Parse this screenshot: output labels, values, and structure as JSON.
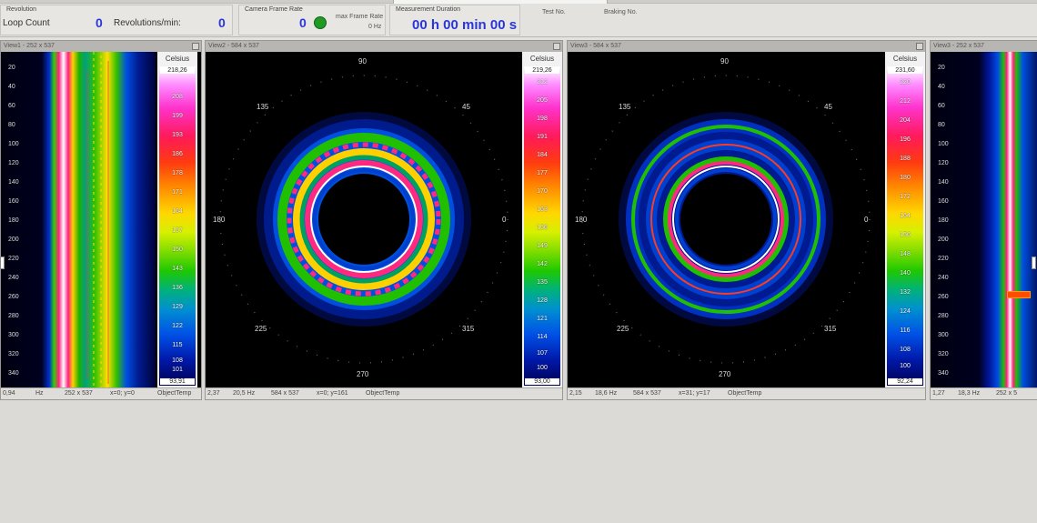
{
  "topbar": {
    "revolution_title": "Revolution",
    "loop_count_label": "Loop Count",
    "loop_count_value": "0",
    "revs_label": "Revolutions/min:",
    "revs_value": "0",
    "frame_rate_title": "Camera Frame Rate",
    "frame_rate_value": "0",
    "max_frame_rate_label": "max Frame Rate",
    "max_frame_rate_unit": "0 Hz",
    "duration_title": "Measurement Duration",
    "duration_value": "00 h 00 min 00 s",
    "test_no_label": "Test No.",
    "braking_no_label": "Braking No."
  },
  "views": {
    "view1": {
      "title": "View1 - 252 x 537",
      "scale_unit": "Celsius",
      "scale_max": "218,26",
      "scale_min": "93,91",
      "scale_ticks": [
        "208",
        "199",
        "193",
        "186",
        "178",
        "171",
        "164",
        "157",
        "150",
        "143",
        "136",
        "129",
        "122",
        "115",
        "108",
        "101"
      ],
      "y_ticks": [
        "20",
        "40",
        "60",
        "80",
        "100",
        "120",
        "140",
        "160",
        "180",
        "200",
        "220",
        "240",
        "260",
        "280",
        "300",
        "320",
        "340"
      ],
      "status": [
        "0,94",
        "Hz",
        "252 x 537",
        "x=0; y=0",
        "ObjectTemp"
      ]
    },
    "view2": {
      "title": "View2 - 584 x 537",
      "scale_unit": "Celsius",
      "scale_max": "219,26",
      "scale_min": "93,00",
      "scale_ticks": [
        "212",
        "205",
        "198",
        "191",
        "184",
        "177",
        "170",
        "163",
        "156",
        "149",
        "142",
        "135",
        "128",
        "121",
        "114",
        "107",
        "100"
      ],
      "angles": {
        "a90": "90",
        "a45": "45",
        "a135": "135",
        "a180": "180",
        "a0": "0",
        "a225": "225",
        "a315": "315",
        "a270": "270"
      },
      "status": [
        "2,37",
        "20,5 Hz",
        "584 x 537",
        "x=0; y=161",
        "ObjectTemp"
      ]
    },
    "view3": {
      "title": "View3 - 584 x 537",
      "scale_unit": "Celsius",
      "scale_max": "231,60",
      "scale_min": "92,24",
      "scale_ticks": [
        "220",
        "212",
        "204",
        "196",
        "188",
        "180",
        "172",
        "164",
        "156",
        "148",
        "140",
        "132",
        "124",
        "116",
        "108",
        "100"
      ],
      "angles": {
        "a90": "90",
        "a45": "45",
        "a135": "135",
        "a180": "180",
        "a0": "0",
        "a225": "225",
        "a315": "315",
        "a270": "270"
      },
      "status": [
        "2,15",
        "18,6 Hz",
        "584 x 537",
        "x=31; y=17",
        "ObjectTemp"
      ]
    },
    "view4": {
      "title": "View3 - 252 x 537",
      "y_ticks": [
        "20",
        "40",
        "60",
        "80",
        "100",
        "120",
        "140",
        "160",
        "180",
        "200",
        "220",
        "240",
        "260",
        "280",
        "300",
        "320",
        "340"
      ],
      "status": [
        "1,27",
        "18,3 Hz",
        "252 x 5"
      ]
    }
  },
  "colors": {
    "accent_blue": "#2a36d8",
    "status_green": "#1f9a22"
  }
}
